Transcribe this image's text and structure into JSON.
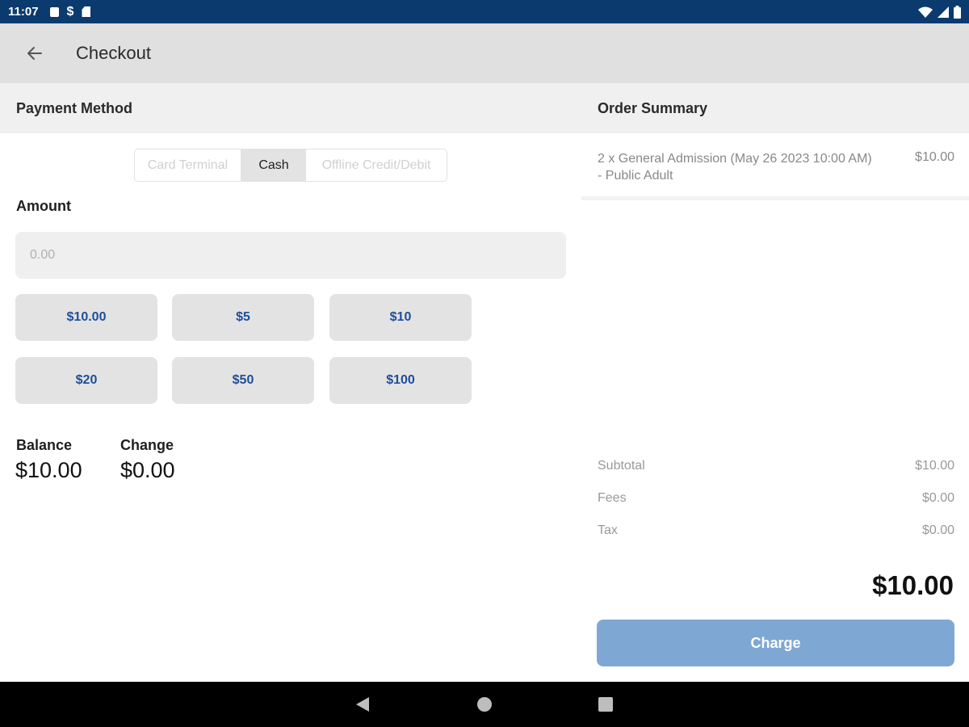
{
  "status_bar": {
    "time": "11:07",
    "icons": [
      "notification-box-icon",
      "dollar-s-icon",
      "sd-card-icon",
      "wifi-icon",
      "signal-icon",
      "battery-icon"
    ]
  },
  "app_bar": {
    "title": "Checkout",
    "back_icon": "arrow-left-icon"
  },
  "payment": {
    "header": "Payment Method",
    "methods": [
      "Card Terminal",
      "Cash",
      "Offline Credit/Debit"
    ],
    "selected_method": "Cash",
    "amount_label": "Amount",
    "amount_placeholder": "0.00",
    "quick_amounts": [
      "$10.00",
      "$5",
      "$10",
      "$20",
      "$50",
      "$100"
    ],
    "balance_label": "Balance",
    "balance_value": "$10.00",
    "change_label": "Change",
    "change_value": "$0.00"
  },
  "order": {
    "header": "Order Summary",
    "items": [
      {
        "description": "2 x General Admission (May 26 2023 10:00 AM) - Public Adult",
        "price": "$10.00"
      }
    ],
    "subtotal_label": "Subtotal",
    "subtotal_value": "$10.00",
    "fees_label": "Fees",
    "fees_value": "$0.00",
    "tax_label": "Tax",
    "tax_value": "$0.00",
    "total": "$10.00",
    "charge_label": "Charge"
  },
  "colors": {
    "status_bar": "#0b3a6e",
    "accent_text": "#1f4d9a",
    "charge_button": "#7fa7d4"
  }
}
